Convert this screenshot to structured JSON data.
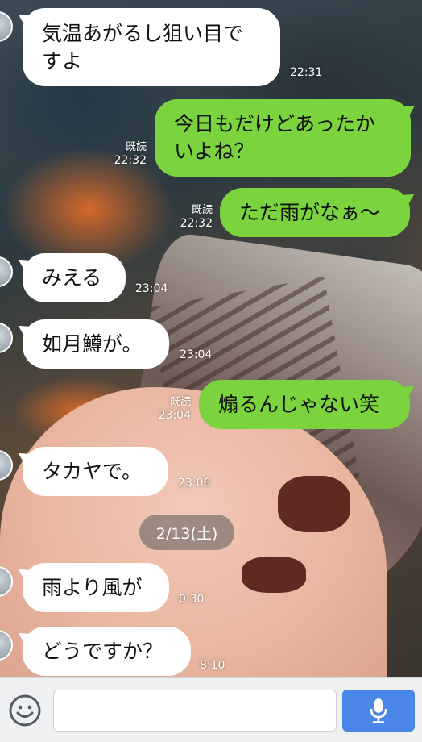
{
  "messages": [
    {
      "side": "left",
      "text": "気温あがるし狙い目で\nすよ",
      "time": "22:31"
    },
    {
      "side": "right",
      "text": "今日もだけどあったか\nいよね？",
      "read": "既読",
      "time": "22:32"
    },
    {
      "side": "right",
      "text": "ただ雨がなぁ〜",
      "read": "既読",
      "time": "22:32"
    },
    {
      "side": "left",
      "text": "みえる",
      "time": "23:04"
    },
    {
      "side": "left",
      "text": "如月鱒が。",
      "time": "23:04"
    },
    {
      "side": "right",
      "text": "煽るんじゃない笑",
      "read": "既読",
      "time": "23:04"
    },
    {
      "side": "left",
      "text": "タカヤで。",
      "time": "23:06"
    },
    {
      "side": "left",
      "text": "雨より風が",
      "time": "0:30"
    },
    {
      "side": "left",
      "text": "どうですか？",
      "time": "8:10"
    }
  ],
  "date_separator": "2/13(土)",
  "input": {
    "placeholder": "",
    "value": ""
  },
  "icons": {
    "emoji": "smiley-icon",
    "send": "microphone-icon"
  },
  "colors": {
    "outgoing_bubble": "#7bd33d",
    "incoming_bubble": "#ffffff",
    "send_button": "#4a86e8"
  }
}
